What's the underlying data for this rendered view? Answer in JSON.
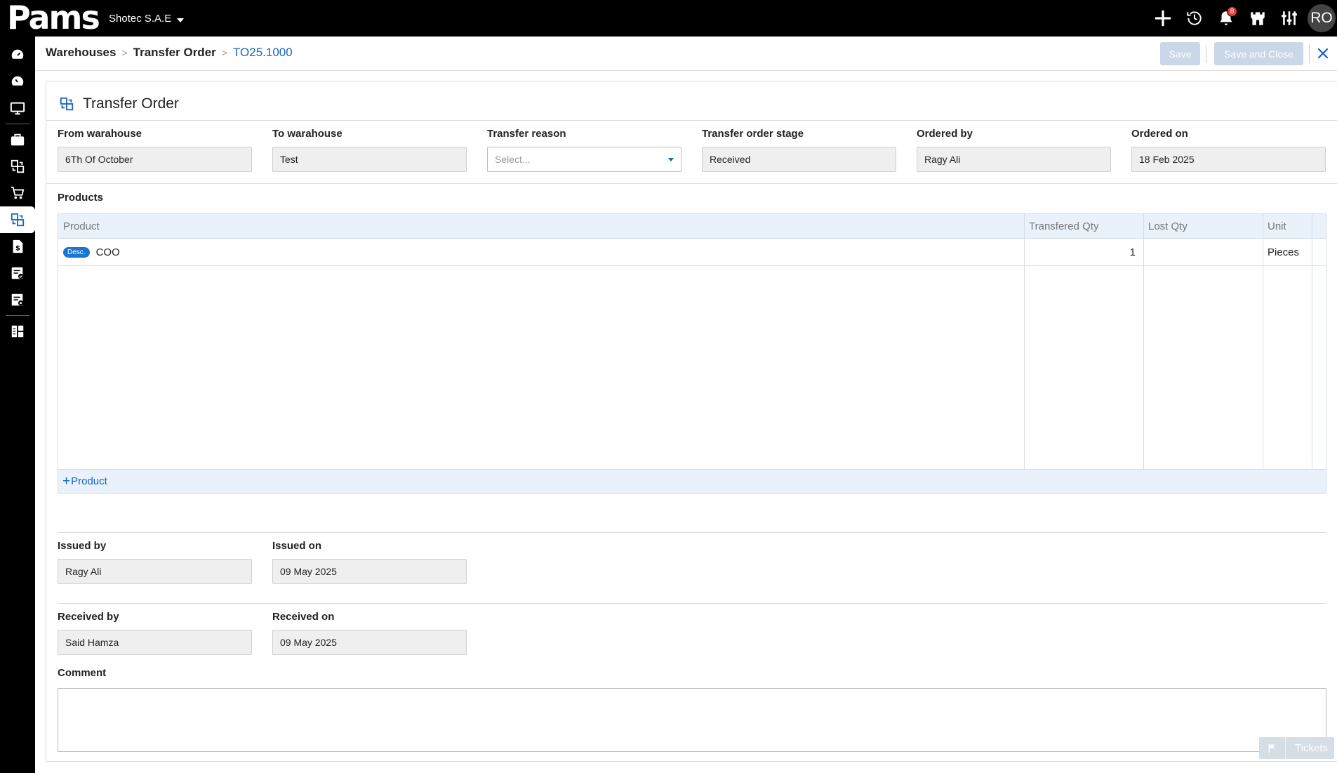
{
  "app": {
    "logo_text": "Pams",
    "company": "Shotec S.A.E",
    "notifications_count": "8",
    "user_initials": "RO"
  },
  "top_icons": [
    "plus-icon",
    "history-icon",
    "bell-icon",
    "castle-icon",
    "sliders-icon"
  ],
  "sidebar": {
    "items": [
      {
        "name": "dashboard-icon"
      },
      {
        "name": "dashboard-alt-icon"
      },
      {
        "name": "monitor-icon"
      },
      {
        "name": "briefcase-icon"
      },
      {
        "name": "transfer-icon"
      },
      {
        "name": "cart-icon"
      },
      {
        "name": "warehouse-transfer-icon",
        "active": true
      },
      {
        "name": "invoice-dollar-icon"
      },
      {
        "name": "checklist-icon"
      },
      {
        "name": "settings-list-icon"
      },
      {
        "name": "grid-icon"
      }
    ]
  },
  "breadcrumb": {
    "items": [
      "Warehouses",
      "Transfer Order"
    ],
    "current": "TO25.1000"
  },
  "toolbar": {
    "save_label": "Save",
    "save_close_label": "Save and Close"
  },
  "form": {
    "title": "Transfer Order",
    "from_warehouse": {
      "label": "From warahouse",
      "value": "6Th Of October"
    },
    "to_warehouse": {
      "label": "To warahouse",
      "value": "Test"
    },
    "transfer_reason": {
      "label": "Transfer reason",
      "placeholder": "Select..."
    },
    "stage": {
      "label": "Transfer order stage",
      "value": "Received"
    },
    "ordered_by": {
      "label": "Ordered by",
      "value": "Ragy Ali"
    },
    "ordered_on": {
      "label": "Ordered on",
      "value": "18 Feb 2025"
    },
    "issued_by": {
      "label": "Issued by",
      "value": "Ragy Ali"
    },
    "issued_on": {
      "label": "Issued on",
      "value": "09 May 2025"
    },
    "received_by": {
      "label": "Received by",
      "value": "Said Hamza"
    },
    "received_on": {
      "label": "Received on",
      "value": "09 May 2025"
    },
    "comment": {
      "label": "Comment",
      "value": ""
    }
  },
  "products": {
    "label": "Products",
    "columns": [
      "Product",
      "Transfered Qty",
      "Lost Qty",
      "Unit"
    ],
    "rows": [
      {
        "tag": "Desc.",
        "product": "COO",
        "transfered_qty": "1",
        "lost_qty": "",
        "unit": "Pieces"
      }
    ],
    "add_label": "Product"
  },
  "tickets_label": "Tickets"
}
